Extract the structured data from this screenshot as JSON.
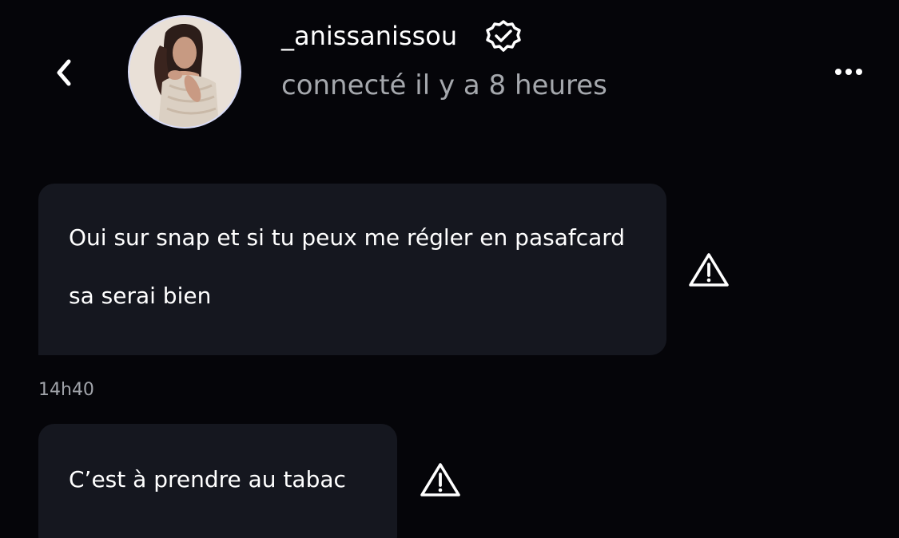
{
  "header": {
    "back_icon": "chevron-left-icon",
    "username": "_anissanissou",
    "verified_icon": "verified-badge-icon",
    "status": "connecté il y a 8 heures",
    "more_icon": "more-horizontal-icon"
  },
  "messages": [
    {
      "text": "Oui sur snap et si tu peux me régler en pasafcard sa serai bien",
      "icon": "warning-icon"
    },
    {
      "timestamp": "14h40",
      "text": "C’est à prendre au tabac",
      "icon": "warning-icon"
    }
  ],
  "colors": {
    "background": "#050509",
    "bubble": "#15171f",
    "secondary_text": "#a5a8ad",
    "avatar_border": "#d9dcf7"
  }
}
